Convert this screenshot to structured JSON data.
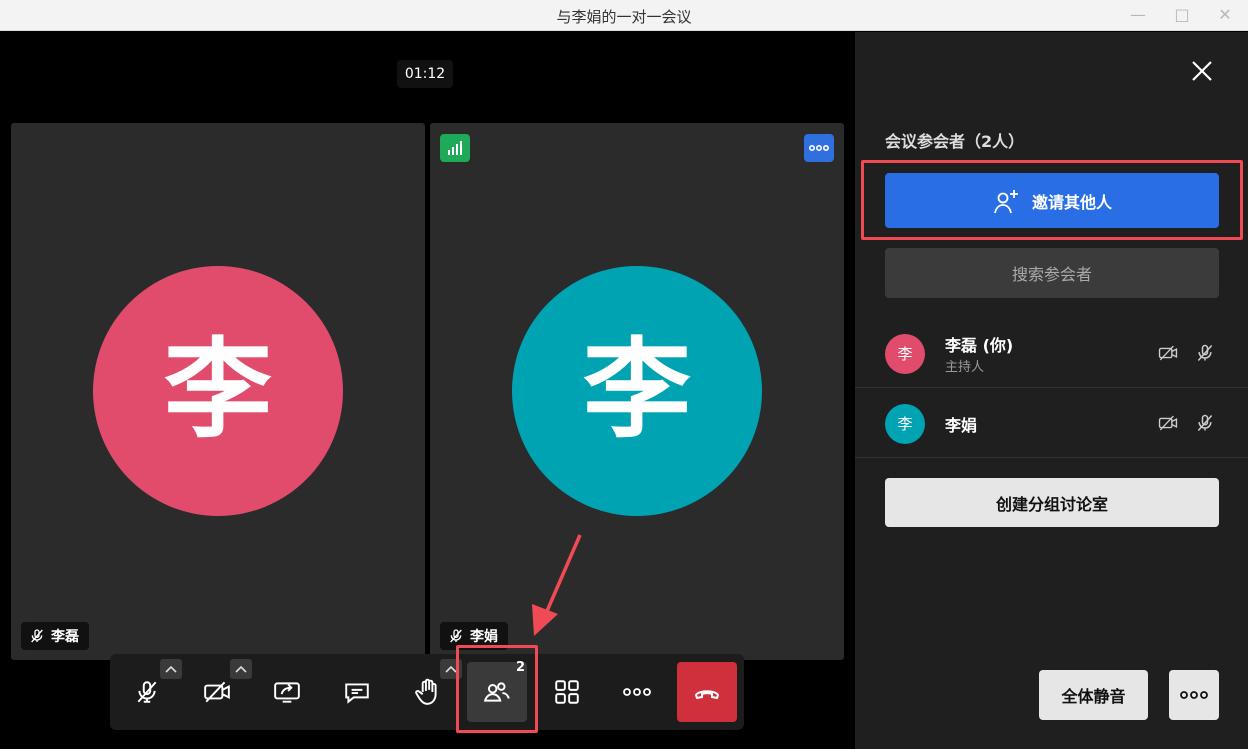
{
  "window": {
    "title": "与李娟的一对一会议",
    "minimize_glyph": "—",
    "maximize_glyph": "□",
    "close_glyph": "✕"
  },
  "meeting": {
    "timer": "01:12",
    "tiles": [
      {
        "name": "李磊",
        "initial": "李",
        "color": "#e14c6c",
        "mic": "muted"
      },
      {
        "name": "李娟",
        "initial": "李",
        "color": "#00a3b1",
        "mic": "muted"
      }
    ]
  },
  "toolbar": {
    "participants_count": "2",
    "buttons": [
      "mic-muted-icon",
      "camera-off-icon",
      "share-screen-icon",
      "chat-icon",
      "raise-hand-icon",
      "participants-icon",
      "layout-grid-icon",
      "more-icon",
      "hang-up-icon"
    ]
  },
  "panel": {
    "title": "会议参会者（2人）",
    "invite_label": "邀请其他人",
    "search_label": "搜索参会者",
    "participants": [
      {
        "initial": "李",
        "name": "李磊 (你)",
        "role": "主持人",
        "color": "#e14c6c"
      },
      {
        "initial": "李",
        "name": "李娟",
        "role": "",
        "color": "#00a3b1"
      }
    ],
    "breakout_label": "创建分组讨论室",
    "mute_all_label": "全体静音"
  },
  "colors": {
    "accent": "#2a6ee6",
    "hangup": "#d0303c",
    "highlight": "#f04a55"
  }
}
